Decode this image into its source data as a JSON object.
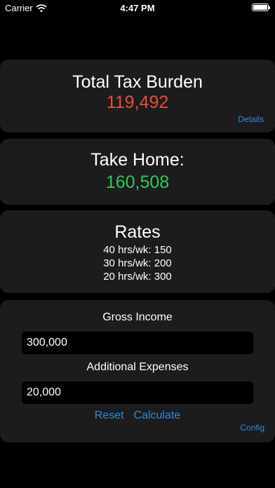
{
  "status_bar": {
    "carrier": "Carrier",
    "time": "4:47 PM",
    "wifi_icon": "wifi-icon",
    "battery_icon": "battery-icon"
  },
  "tax_burden": {
    "title": "Total Tax Burden",
    "value": "119,492",
    "details_label": "Details"
  },
  "take_home": {
    "title": "Take Home:",
    "value": "160,508"
  },
  "rates": {
    "title": "Rates",
    "lines": [
      "40 hrs/wk: 150",
      "30 hrs/wk: 200",
      "20 hrs/wk: 300"
    ]
  },
  "inputs": {
    "gross_income_label": "Gross Income",
    "gross_income_value": "300,000",
    "additional_expenses_label": "Additional Expenses",
    "additional_expenses_value": "20,000",
    "reset_label": "Reset",
    "calculate_label": "Calculate",
    "config_label": "Config"
  },
  "colors": {
    "background": "#000000",
    "card": "#1c1c1e",
    "tax_value": "#e84d3d",
    "take_home_value": "#34c759",
    "link": "#2f8bd8"
  }
}
